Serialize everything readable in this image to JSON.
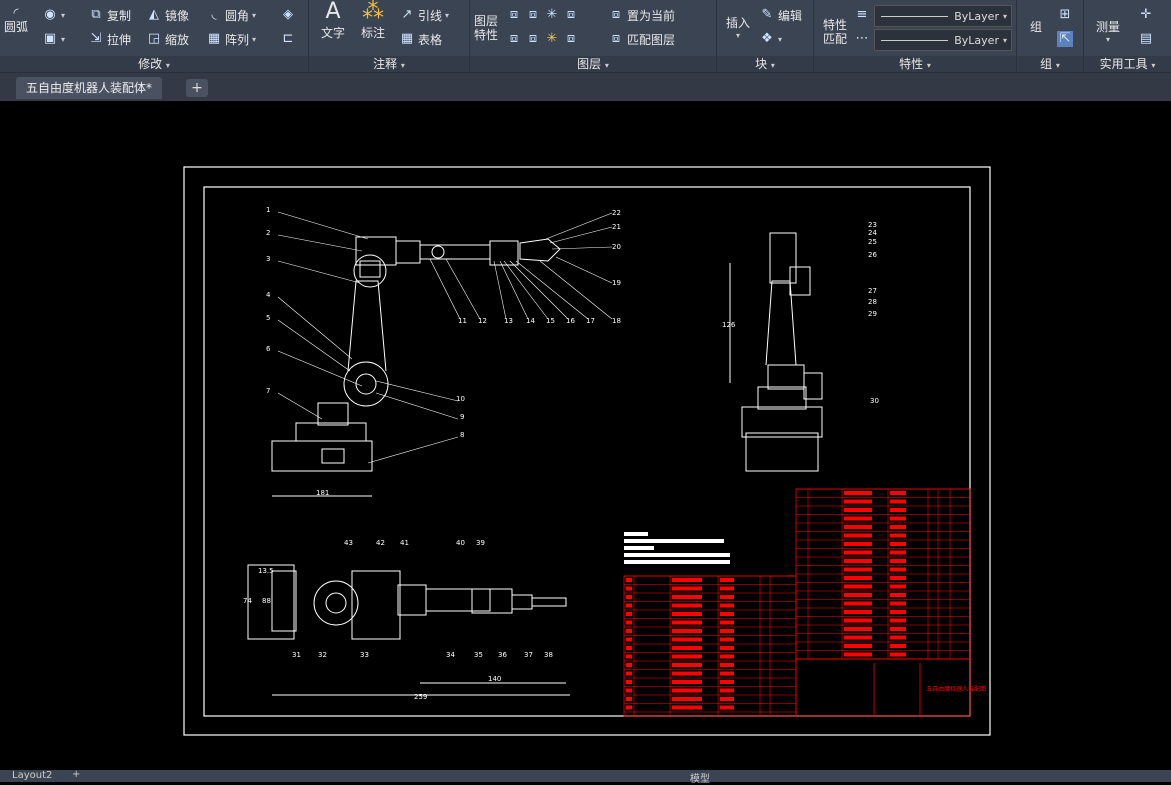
{
  "ribbon": {
    "modify": {
      "title": "修改",
      "arc": "圆弧",
      "copy": "复制",
      "mirror": "镜像",
      "fillet": "圆角",
      "stretch": "拉伸",
      "scale": "缩放",
      "array": "阵列"
    },
    "annotation": {
      "title": "注释",
      "text": "文字",
      "dimension": "标注",
      "leader": "引线",
      "table": "表格"
    },
    "layers": {
      "title": "图层",
      "layer_props": "图层特性",
      "set_current": "置为当前",
      "match_layer": "匹配图层"
    },
    "block": {
      "title": "块",
      "insert": "插入",
      "edit": "编辑"
    },
    "properties": {
      "title": "特性",
      "match": "特性匹配",
      "lineweight_value": "ByLayer",
      "linetype_value": "ByLayer"
    },
    "groups": {
      "title": "组",
      "group": "组"
    },
    "utilities": {
      "title": "实用工具",
      "measure": "测量"
    }
  },
  "tabs": {
    "active": "五自由度机器人装配体*",
    "add": "+"
  },
  "status": {
    "layout": "Layout2",
    "model": "模型"
  },
  "drawing": {
    "side_labels": [
      "1",
      "2",
      "3",
      "4",
      "5",
      "6",
      "7",
      "8",
      "9",
      "10",
      "11",
      "12",
      "13",
      "14",
      "15",
      "16",
      "17",
      "18",
      "19",
      "20",
      "21",
      "22"
    ],
    "right_labels": [
      "23",
      "24",
      "25",
      "26",
      "27",
      "28",
      "29",
      "30"
    ],
    "bottom_labels": [
      "31",
      "32",
      "33",
      "34",
      "35",
      "36",
      "37",
      "38",
      "39",
      "40",
      "41",
      "42",
      "43"
    ],
    "dims": [
      "181",
      "126",
      "74",
      "88",
      "140",
      "259",
      "13.5"
    ],
    "title_block": "五自由度机器人装配图",
    "colors": {
      "frame": "#ffffff",
      "table": "#ff0000",
      "ui_bg": "#3b4453"
    }
  }
}
